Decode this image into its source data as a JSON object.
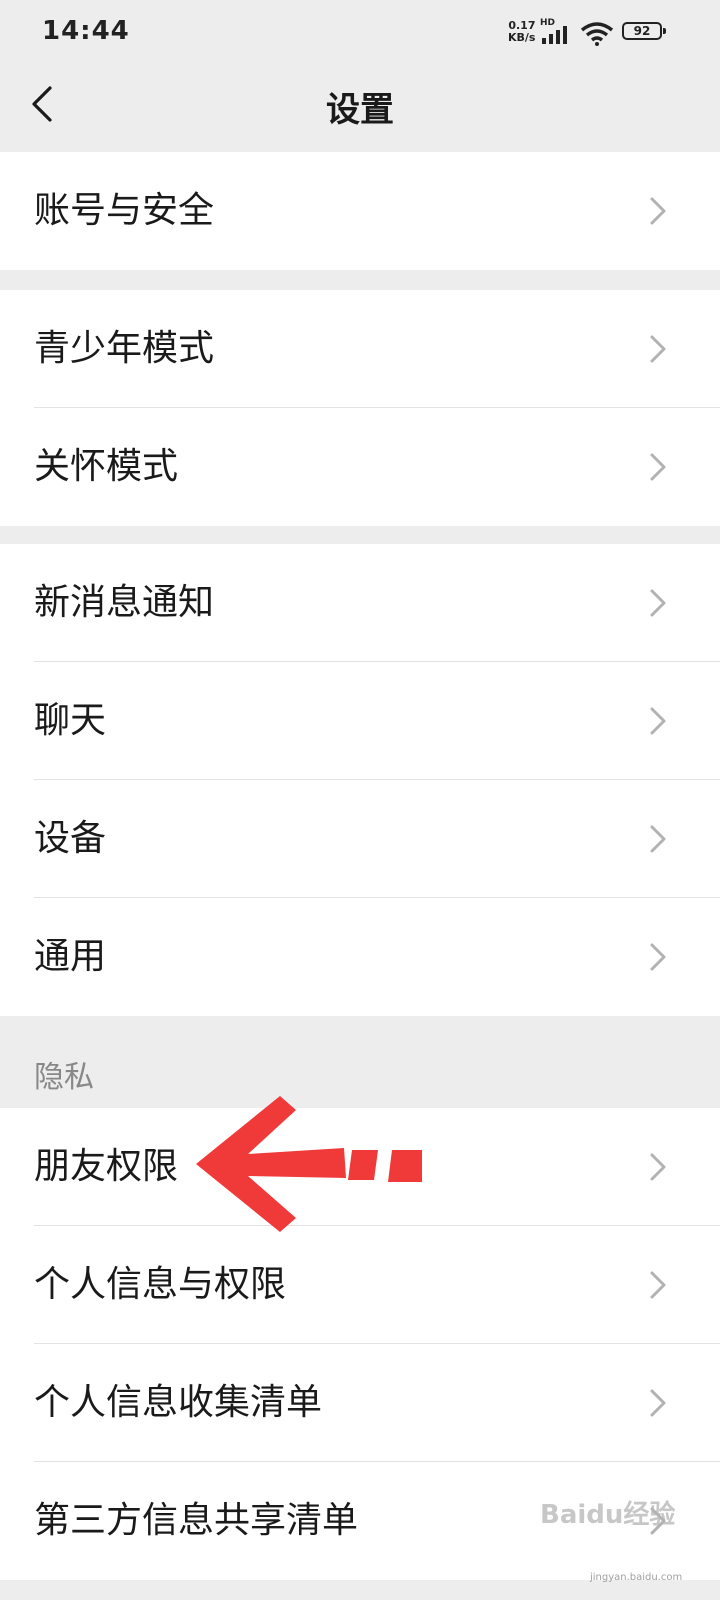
{
  "status_bar": {
    "time": "14:44",
    "net_speed_value": "0.17",
    "net_speed_unit": "KB/s",
    "network_type": "HD",
    "battery": "92"
  },
  "nav": {
    "title": "设置",
    "back_icon": "chevron-left-icon"
  },
  "groups": [
    {
      "items": [
        {
          "label": "账号与安全"
        }
      ]
    },
    {
      "items": [
        {
          "label": "青少年模式"
        },
        {
          "label": "关怀模式"
        }
      ]
    },
    {
      "items": [
        {
          "label": "新消息通知"
        },
        {
          "label": "聊天"
        },
        {
          "label": "设备"
        },
        {
          "label": "通用"
        }
      ]
    }
  ],
  "privacy": {
    "header": "隐私",
    "items": [
      {
        "label": "朋友权限"
      },
      {
        "label": "个人信息与权限"
      },
      {
        "label": "个人信息收集清单"
      },
      {
        "label": "第三方信息共享清单"
      }
    ]
  },
  "colors": {
    "page_background": "#ededed",
    "row_background": "#ffffff",
    "annotation_arrow": "#f03a3a"
  },
  "watermark": {
    "text": "Baidu经验",
    "url_text": "jingyan.baidu.com"
  }
}
